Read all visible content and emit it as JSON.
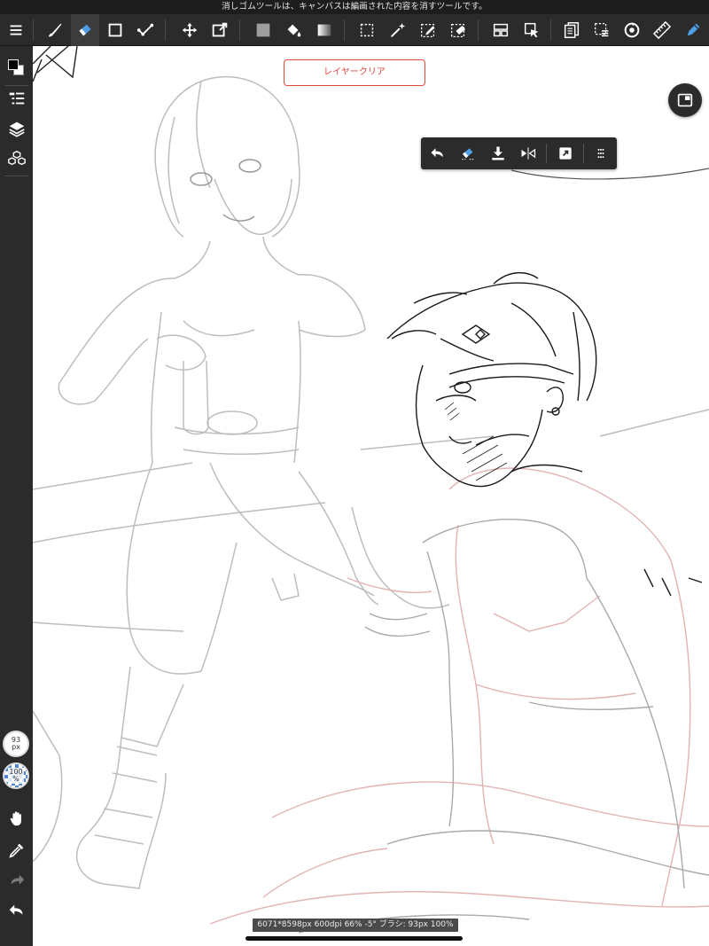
{
  "status_hint": "消しゴムツールは、キャンバスは編画された内容を消すツールです。",
  "toolbar": {
    "icons": [
      "menu-icon",
      "brush-tool-icon",
      "eraser-tool-icon",
      "rectangle-shape-icon",
      "stroke-correction-icon",
      "move-tool-icon",
      "transform-tool-icon",
      "fill-color-icon",
      "bucket-fill-icon",
      "gradient-icon",
      "rect-select-icon",
      "magic-wand-icon",
      "select-pen-icon",
      "select-eraser-icon",
      "layout-icon",
      "select-arrow-icon",
      "copy-layer-icon",
      "canvas-select-icon",
      "rotate-icon",
      "ruler-icon",
      "pen-settings-icon"
    ]
  },
  "sidebar": {
    "brush_size_label": "93\npx",
    "opacity_label": "100\n%"
  },
  "canvas": {
    "clear_layer_label": "レイヤークリア"
  },
  "status_info": "6071*8598px 600dpi 66% -5° ブラシ: 93px 100%",
  "colors": {
    "toolbar_bg": "#2b2b2b",
    "accent_blue": "#4e9ee6",
    "clear_red": "#e0483e",
    "sketch_gray": "#b9b9b9",
    "sketch_pink": "#e4b6b6"
  }
}
